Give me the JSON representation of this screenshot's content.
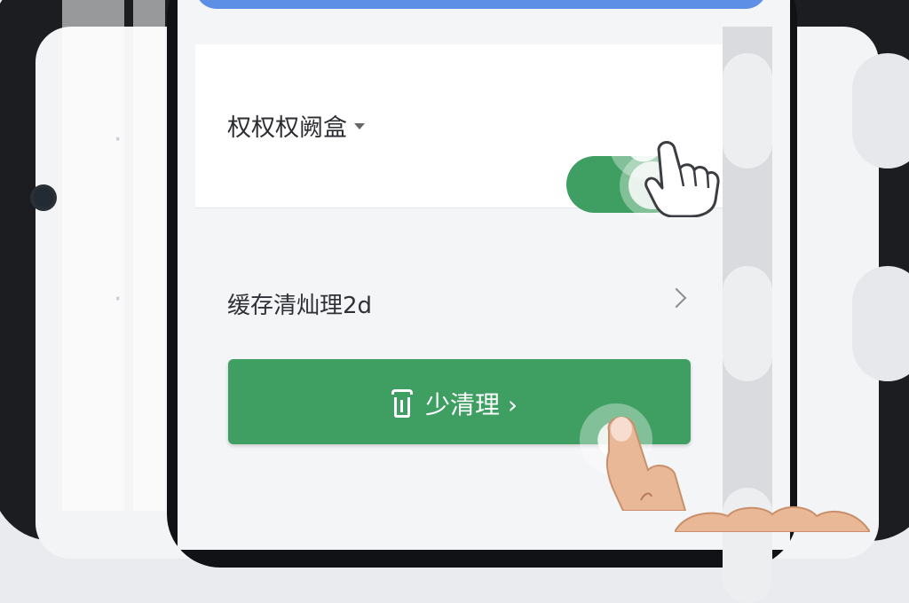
{
  "settings": {
    "toggle_row_label": "权权权阙盒",
    "toggle_state": "on",
    "cache_row_label": "缓存清灿理2d",
    "clean_button_label": "少清理 ›"
  },
  "colors": {
    "accent_green": "#3f9e62",
    "top_bar_blue": "#5e8fe6",
    "screen_bg": "#f4f5f7"
  },
  "icons": {
    "dropdown": "chevron-down-icon",
    "cache_row_arrow": "chevron-right-icon",
    "clean_button_icon": "trash-icon",
    "gesture_toggle": "tap-hand-icon",
    "gesture_button": "finger-icon"
  }
}
